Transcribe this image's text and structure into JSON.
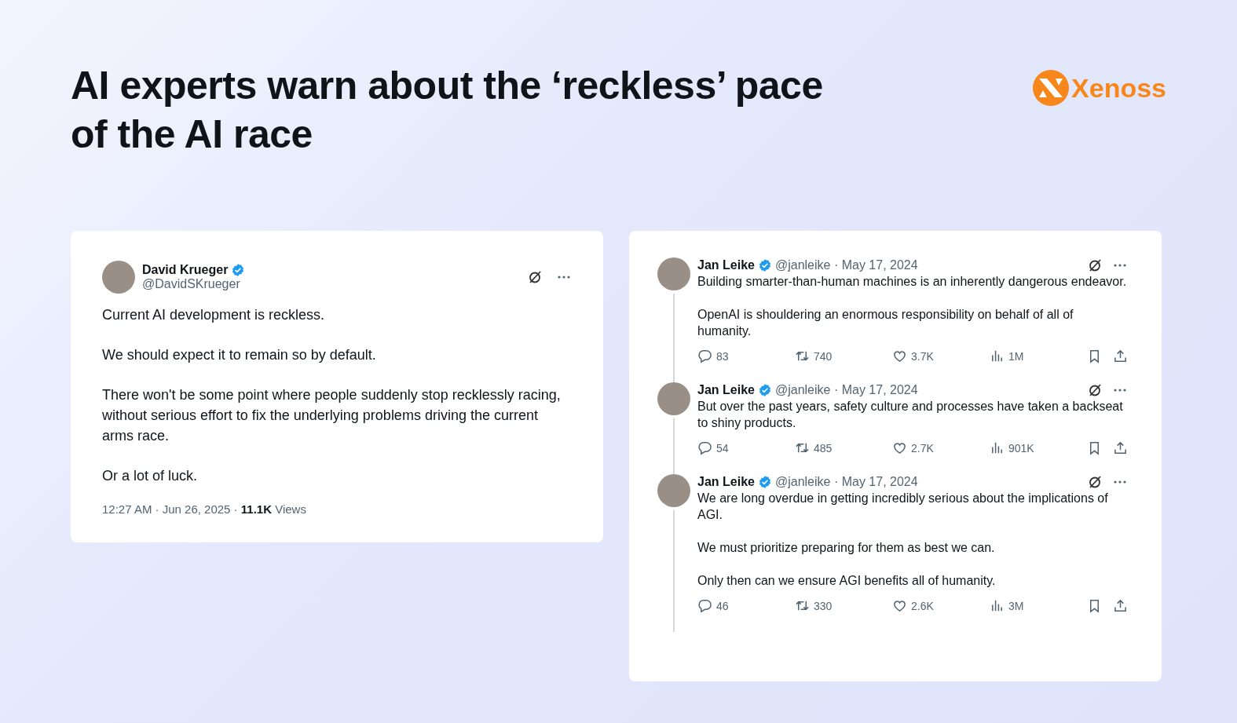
{
  "title_lines": [
    "AI experts warn about the ‘reckless’ pace",
    "of the AI race"
  ],
  "logo": {
    "text": "Xenoss"
  },
  "main_tweet": {
    "name": "David Krueger",
    "verified": true,
    "handle": "@DavidSKrueger",
    "paragraphs": [
      "Current AI development is reckless.",
      "We should expect it to remain so by default.",
      "There won't be some point where people suddenly stop recklessly racing, without serious effort to fix the underlying problems driving the current arms race.",
      "Or a lot of luck."
    ],
    "meta": "12:27 AM · Jun 26, 2025 · **11.1K** Views"
  },
  "thread": [
    {
      "name": "Jan Leike",
      "verified": true,
      "handle": "@janleike · May 17, 2024",
      "paragraphs": [
        "Building smarter-than-human machines is an inherently dangerous endeavor.",
        "OpenAI is shouldering an enormous responsibility on behalf of all of humanity."
      ],
      "replies": "83",
      "reposts": "740",
      "likes": "3.7K",
      "views": "1M"
    },
    {
      "name": "Jan Leike",
      "verified": true,
      "handle": "@janleike · May 17, 2024",
      "paragraphs": [
        "But over the past years, safety culture and processes have taken a backseat to shiny products."
      ],
      "replies": "54",
      "reposts": "485",
      "likes": "2.7K",
      "views": "901K"
    },
    {
      "name": "Jan Leike",
      "verified": true,
      "handle": "@janleike · May 17, 2024",
      "paragraphs": [
        "We are long overdue in getting incredibly serious about the implications of AGI.",
        "We must prioritize preparing for them as best we can.",
        "Only then can we ensure AGI benefits all of humanity."
      ],
      "replies": "46",
      "reposts": "330",
      "likes": "2.6K",
      "views": "3M"
    }
  ]
}
